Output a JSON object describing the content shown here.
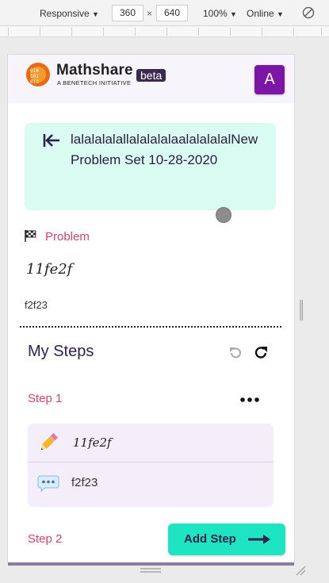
{
  "devtools": {
    "device": "Responsive",
    "width": "360",
    "separator": "×",
    "height": "640",
    "zoom": "100%",
    "network": "Online",
    "dropdown_arrow": "▼"
  },
  "header": {
    "brand": "Mathshare",
    "tagline": "A BENETECH INITIATIVE",
    "badge": "beta",
    "avatar_letter": "A",
    "avatar_color": "#7b16a6"
  },
  "problem_set": {
    "title": "lalalalalallalalalalaalalalalalNew Problem Set 10-28-2020"
  },
  "problem": {
    "label": "Problem",
    "equation": "11fe2f",
    "text": "f2f23"
  },
  "steps": {
    "title": "My Steps",
    "items": [
      {
        "label": "Step 1",
        "equation": "11fe2f",
        "explanation": "f2f23"
      },
      {
        "label": "Step 2"
      }
    ],
    "add_button_label": "Add Step"
  },
  "colors": {
    "accent_pink": "#d6426f",
    "title_card_bg": "#d9fbf2",
    "step_card_bg": "#f3eefa",
    "add_step_bg": "#1de5c2",
    "text_dark": "#2f2150"
  },
  "icons": [
    "rotate-icon",
    "back-arrow-icon",
    "flag-icon",
    "undo-icon",
    "redo-icon",
    "more-options-icon",
    "pencil-icon",
    "comment-icon",
    "arrow-right-icon"
  ]
}
